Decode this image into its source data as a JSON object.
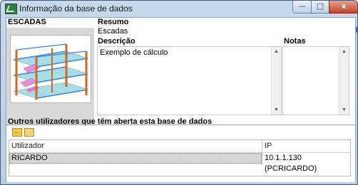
{
  "window": {
    "title": "Informação da base de dados",
    "controls": {
      "minimize": "—",
      "maximize": "□",
      "close": "x"
    }
  },
  "database": {
    "name": "ESCADAS",
    "summary_label": "Resumo",
    "summary_value": "Escadas",
    "description_label": "Descrição",
    "description_value": "Exemplo de cálculo",
    "notes_label": "Notas",
    "notes_value": ""
  },
  "users_section": {
    "title": "Outros utilizadores que têm aberta esta base de dados",
    "toolbar": [
      "message-icon",
      "contact-icon"
    ],
    "columns": [
      "Utilizador",
      "IP"
    ],
    "rows": [
      {
        "user": "RICARDO",
        "ip": "10.1.1.130 (PCRICARDO)"
      }
    ]
  },
  "help_glyph": "?"
}
